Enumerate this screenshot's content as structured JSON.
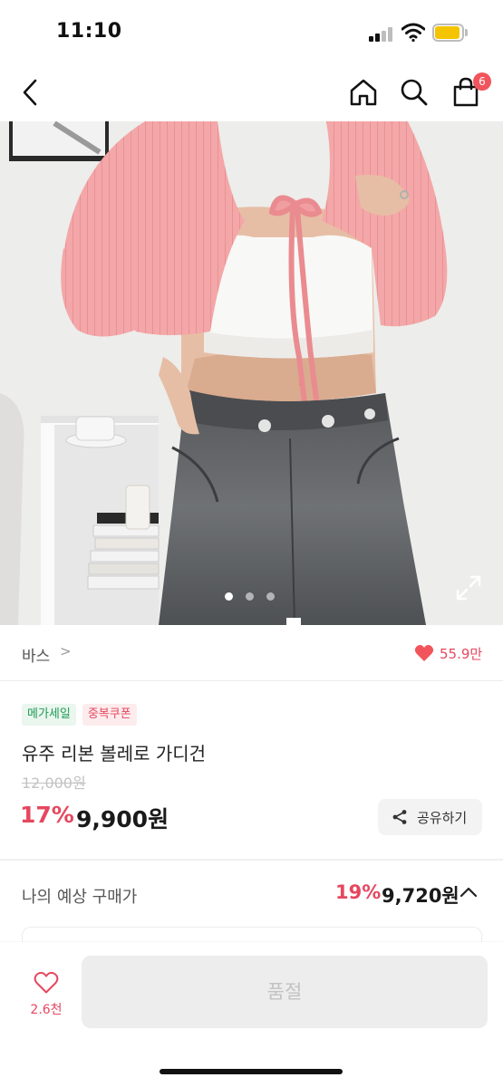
{
  "status_bar": {
    "time": "11:10"
  },
  "nav": {
    "back_icon": "chevron-left-icon",
    "home_icon": "home-icon",
    "search_icon": "search-icon",
    "cart_icon": "shopping-bag-icon",
    "cart_count": "6"
  },
  "gallery": {
    "total_images": 3,
    "current_index": 1
  },
  "brand": {
    "name": "바스",
    "chevron": ">",
    "like_count": "55.9만"
  },
  "product": {
    "badges": [
      {
        "label": "메가세일",
        "style": "green"
      },
      {
        "label": "중복쿠폰",
        "style": "red"
      }
    ],
    "name": "유주 리본 볼레로 가디건",
    "original_price": "12,000원",
    "discount_rate": "17%",
    "sale_price": "9,900원",
    "share_label": "공유하기"
  },
  "expected_price": {
    "label": "나의 예상 구매가",
    "discount_rate": "19%",
    "price": "9,720원"
  },
  "bottom_bar": {
    "wish_count": "2.6천",
    "soldout_label": "품절"
  },
  "colors": {
    "accent": "#e5485f",
    "badge_green": "#1f9a57",
    "battery": "#f5c400"
  }
}
